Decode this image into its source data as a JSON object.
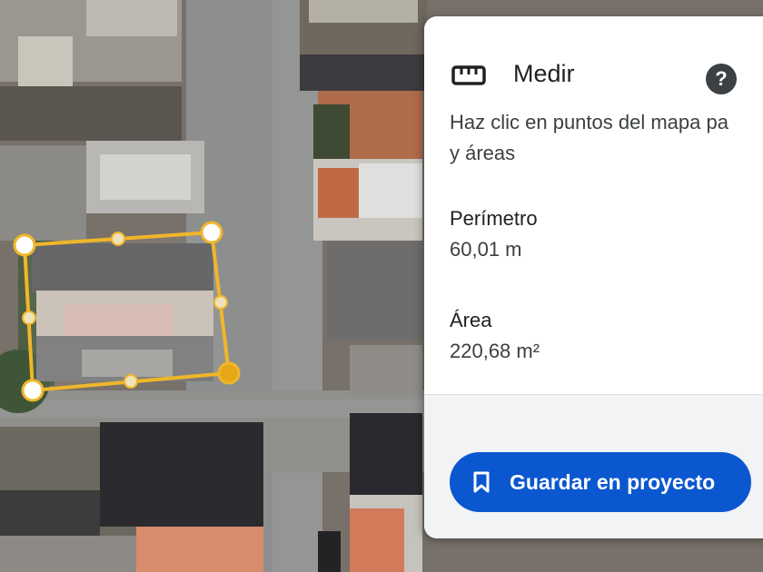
{
  "panel": {
    "title": "Medir",
    "icon": "ruler-icon",
    "help_icon": "help-icon",
    "help_glyph": "?",
    "instructions_line1": "Haz clic en puntos del mapa pa",
    "instructions_line2": "y áreas",
    "perimeter_label": "Perímetro",
    "perimeter_value": "60,01 m",
    "area_label": "Área",
    "area_value": "220,68 m²",
    "save_button": {
      "label": "Guardar en proyecto",
      "icon": "bookmark-icon"
    }
  },
  "map": {
    "type": "satellite",
    "measurement_shape": "polygon",
    "vertex_count": 4,
    "midpoint_count": 4
  },
  "colors": {
    "measure_line": "#f0b62a",
    "vertex_fill": "#ffffff",
    "active_vertex": "#e6a817",
    "primary_button": "#0b57d0",
    "panel_bg": "#ffffff",
    "footer_bg": "#f1f3f4"
  }
}
